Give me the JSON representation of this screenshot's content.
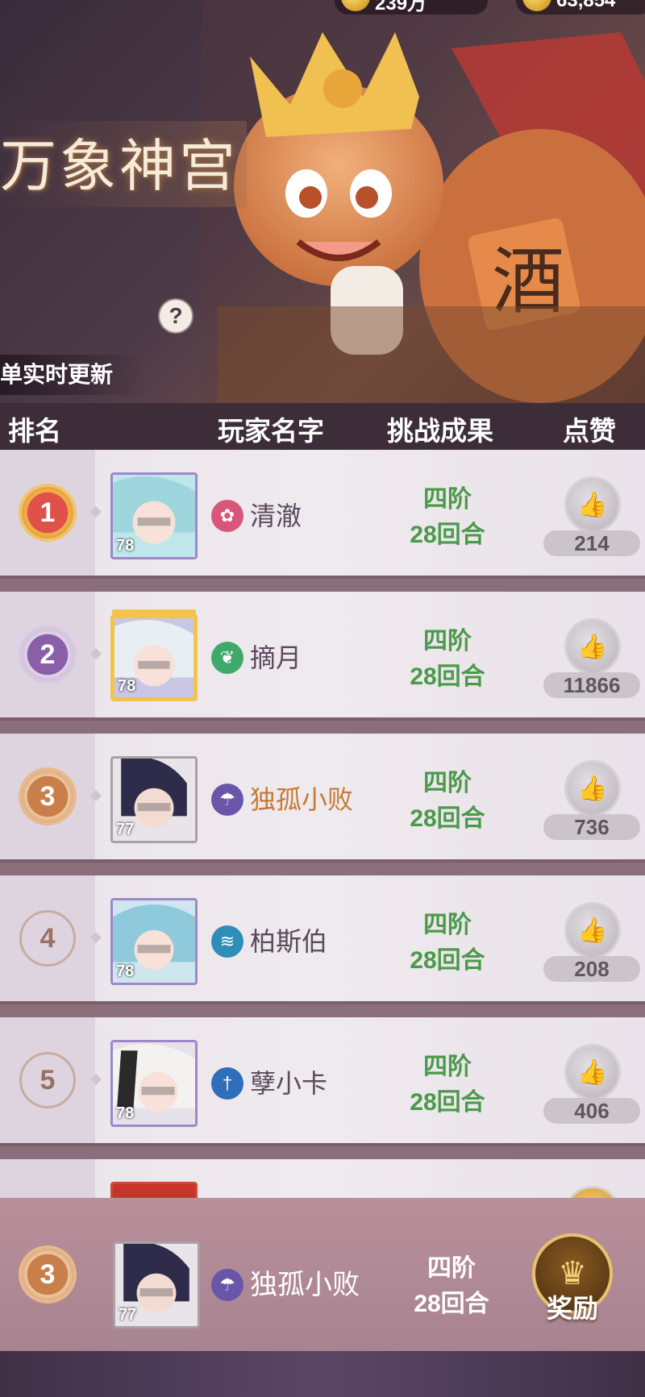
{
  "currency": {
    "gold_amount": "239万",
    "coin_amount": "63,854"
  },
  "banner": {
    "event_title": "万象神宫",
    "help_label": "?",
    "update_note": "单实时更新"
  },
  "columns": {
    "rank": "排名",
    "player_name": "玩家名字",
    "result": "挑战成果",
    "likes": "点赞"
  },
  "rows": [
    {
      "rank": "1",
      "level": "78",
      "name": "清澈",
      "tier": "四阶",
      "rounds": "28回合",
      "likes": "214",
      "class_icon": "flower-icon",
      "class_color": "#d9557a"
    },
    {
      "rank": "2",
      "level": "78",
      "name": "摘月",
      "tier": "四阶",
      "rounds": "28回合",
      "likes": "11866",
      "class_icon": "leaf-icon",
      "class_color": "#3fa86a"
    },
    {
      "rank": "3",
      "level": "77",
      "name": "独孤小败",
      "tier": "四阶",
      "rounds": "28回合",
      "likes": "736",
      "class_icon": "umbrella-icon",
      "class_color": "#6a56a8"
    },
    {
      "rank": "4",
      "level": "78",
      "name": "柏斯伯",
      "tier": "四阶",
      "rounds": "28回合",
      "likes": "208",
      "class_icon": "wave-icon",
      "class_color": "#2f8eb8"
    },
    {
      "rank": "5",
      "level": "78",
      "name": "孽小卡",
      "tier": "四阶",
      "rounds": "28回合",
      "likes": "406",
      "class_icon": "sword-icon",
      "class_color": "#2f6eb8"
    }
  ],
  "self": {
    "rank": "3",
    "level": "77",
    "name": "独孤小败",
    "tier": "四阶",
    "rounds": "28回合",
    "reward_label": "奖励"
  },
  "colors": {
    "result_green": "#4a9a4a",
    "name_orange": "#c57a33"
  }
}
